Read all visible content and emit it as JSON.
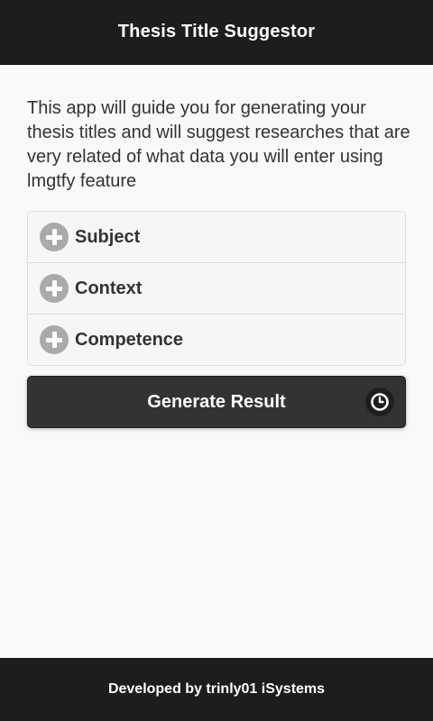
{
  "header": {
    "title": "Thesis Title Suggestor"
  },
  "intro": {
    "text": "This app will guide you for generating your thesis titles and will suggest researches that are very related of what data you will enter using lmgtfy feature"
  },
  "sections": [
    {
      "label": "Subject",
      "icon": "plus-icon",
      "expanded": false
    },
    {
      "label": "Context",
      "icon": "plus-icon",
      "expanded": false
    },
    {
      "label": "Competence",
      "icon": "plus-icon",
      "expanded": false
    }
  ],
  "actions": {
    "generate_label": "Generate Result",
    "generate_icon": "clock-icon"
  },
  "footer": {
    "text": "Developed by trinly01 iSystems"
  },
  "colors": {
    "header_bg": "#1d1d1d",
    "page_bg": "#f9f9f9",
    "button_bg": "#333333",
    "collapsible_bg": "#f6f6f6",
    "icon_bg": "#aaaaaa"
  }
}
